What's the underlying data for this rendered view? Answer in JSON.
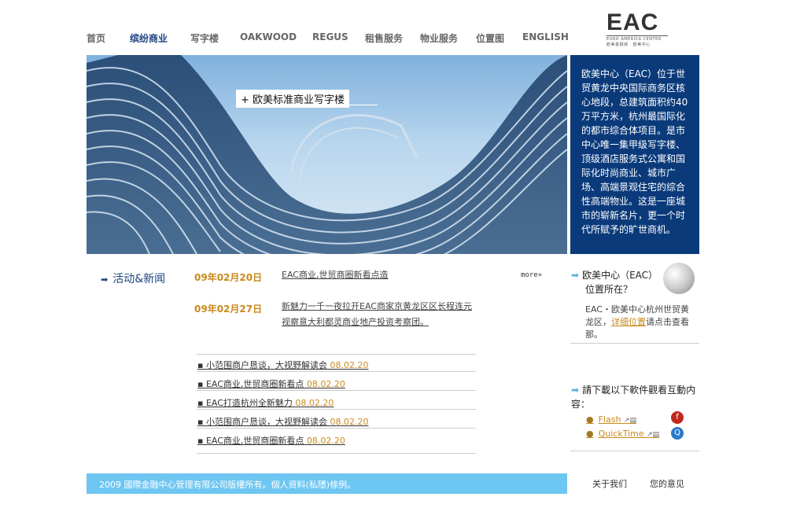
{
  "nav": {
    "items": [
      {
        "label": "首页",
        "color": "#666666"
      },
      {
        "label": "缤纷商业",
        "color": "#1c4480"
      },
      {
        "label": "写字楼",
        "color": "#666666"
      },
      {
        "label": "OAKWOOD",
        "color": "#666666"
      },
      {
        "label": "REGUS",
        "color": "#666666"
      },
      {
        "label": "租售服务",
        "color": "#666666"
      },
      {
        "label": "物业服务",
        "color": "#666666"
      },
      {
        "label": "位置图",
        "color": "#666666"
      },
      {
        "label": "ENGLISH",
        "color": "#666666"
      }
    ]
  },
  "logo": {
    "text": "EAC",
    "subtitle": "EURO AMERICA CENTER",
    "subtitle_cn": "欧美金融城 · 欧美中心"
  },
  "hero": {
    "caption": "+ 欧美标准商业写字楼"
  },
  "intro": {
    "text": "欧美中心（EAC）位于世贸黄龙中央国际商务区核心地段，总建筑面积约40万平方米，杭州最国际化的都市综合体项目。是市中心唯一集甲级写字楼、顶级酒店服务式公寓和国际化时尚商业、城市广场、高端景观住宅的综合性高端物业。这是一座城市的崭新名片，更一个时代所赋予的旷世商机。"
  },
  "news": {
    "heading": "活动&新闻",
    "more": "more»",
    "featured": [
      {
        "date": "09年02月20日",
        "title": "EAC商业,世贸商圈新看点造"
      },
      {
        "date": "09年02月27日",
        "title": "新魅力一千一夜拉开EAC商家京黄龙区区长程连元视察意大利都灵商业地产投资考察团。"
      }
    ],
    "list": [
      {
        "title": "▪ 小范围商户恳谈，大视野解读会",
        "date": "08.02.20"
      },
      {
        "title": "▪ EAC商业,世贸商圈新看点",
        "date": "08.02.20"
      },
      {
        "title": "▪ EAC打造杭州全新魅力",
        "date": "08.02.20"
      },
      {
        "title": "▪ 小范围商户恳谈，大视野解读会",
        "date": "08.02.20"
      },
      {
        "title": "▪ EAC商业,世贸商圈新看点",
        "date": "08.02.20"
      }
    ]
  },
  "sidebar": {
    "location_q1": "欧美中心（EAC）",
    "location_q2": "位置所在？",
    "location_pre": "EAC・欧美中心杭州世贸黄龙区，",
    "location_link": "详细位置",
    "location_post": "请点击查看那。",
    "download_q": "請下載以下軟件觀看互動内容：",
    "downloads": [
      {
        "label": "Flash",
        "sub": "↗▤"
      },
      {
        "label": "QuickTime",
        "sub": "↗▤"
      }
    ]
  },
  "footer": {
    "copyright": "2009 國際金融中心管理有限公司版權所有。個人資料(私隱)條例。",
    "links": [
      "关于我们",
      "您的意见"
    ]
  }
}
